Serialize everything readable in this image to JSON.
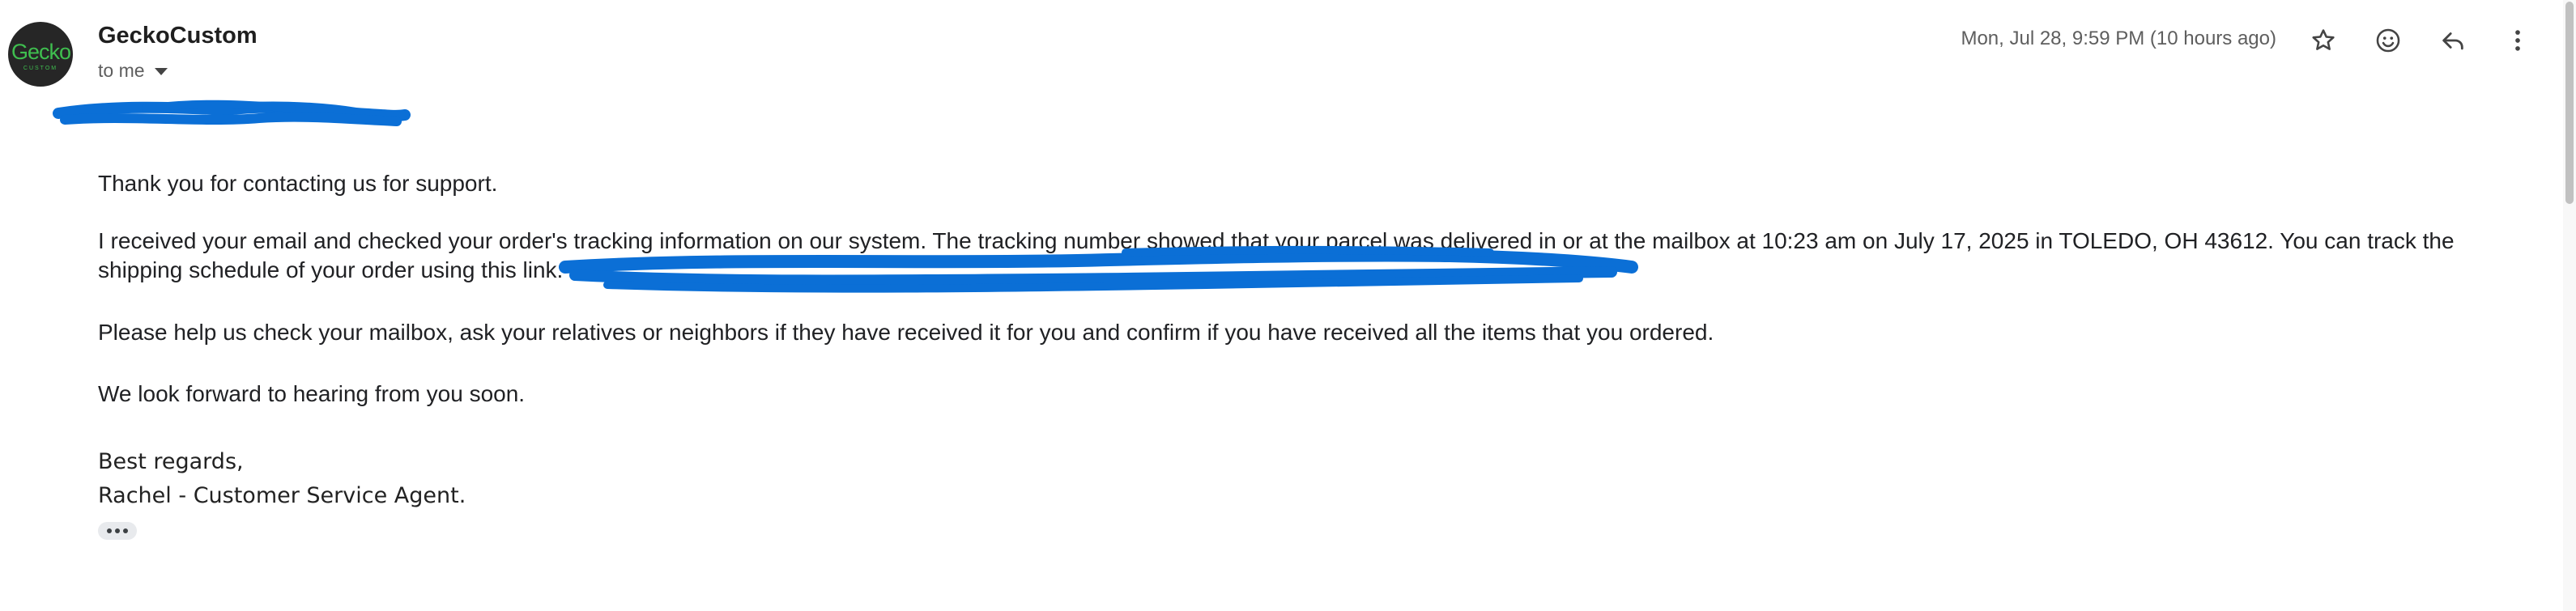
{
  "sender": {
    "name": "GeckoCustom",
    "avatar_word": "Gecko",
    "avatar_sub": "CUSTOM",
    "recipient_label": "to me"
  },
  "header": {
    "timestamp": "Mon, Jul 28, 9:59 PM (10 hours ago)"
  },
  "toolbar": {
    "icons": [
      "star-icon",
      "emoji-icon",
      "reply-icon",
      "more-vertical-icon"
    ]
  },
  "body": {
    "p1": "Thank you for contacting us for support.",
    "p2": "I received your email and checked your order's tracking information on our system. The tracking number showed that your parcel was delivered in or at the mailbox at 10:23 am on July 17, 2025 in TOLEDO, OH 43612. You can track the shipping schedule of your order using this link:",
    "p3": "Please help us check your mailbox, ask your relatives or neighbors if they have received it for you and confirm if you have received all the items that you ordered.",
    "p4": "We look forward to hearing from you soon."
  },
  "signature": {
    "line1": "Best regards,",
    "line2": "Rachel - Customer Service Agent."
  },
  "colors": {
    "redaction": "#0b6fd6",
    "avatar_bg": "#262626",
    "avatar_text": "#3fbf4f"
  }
}
